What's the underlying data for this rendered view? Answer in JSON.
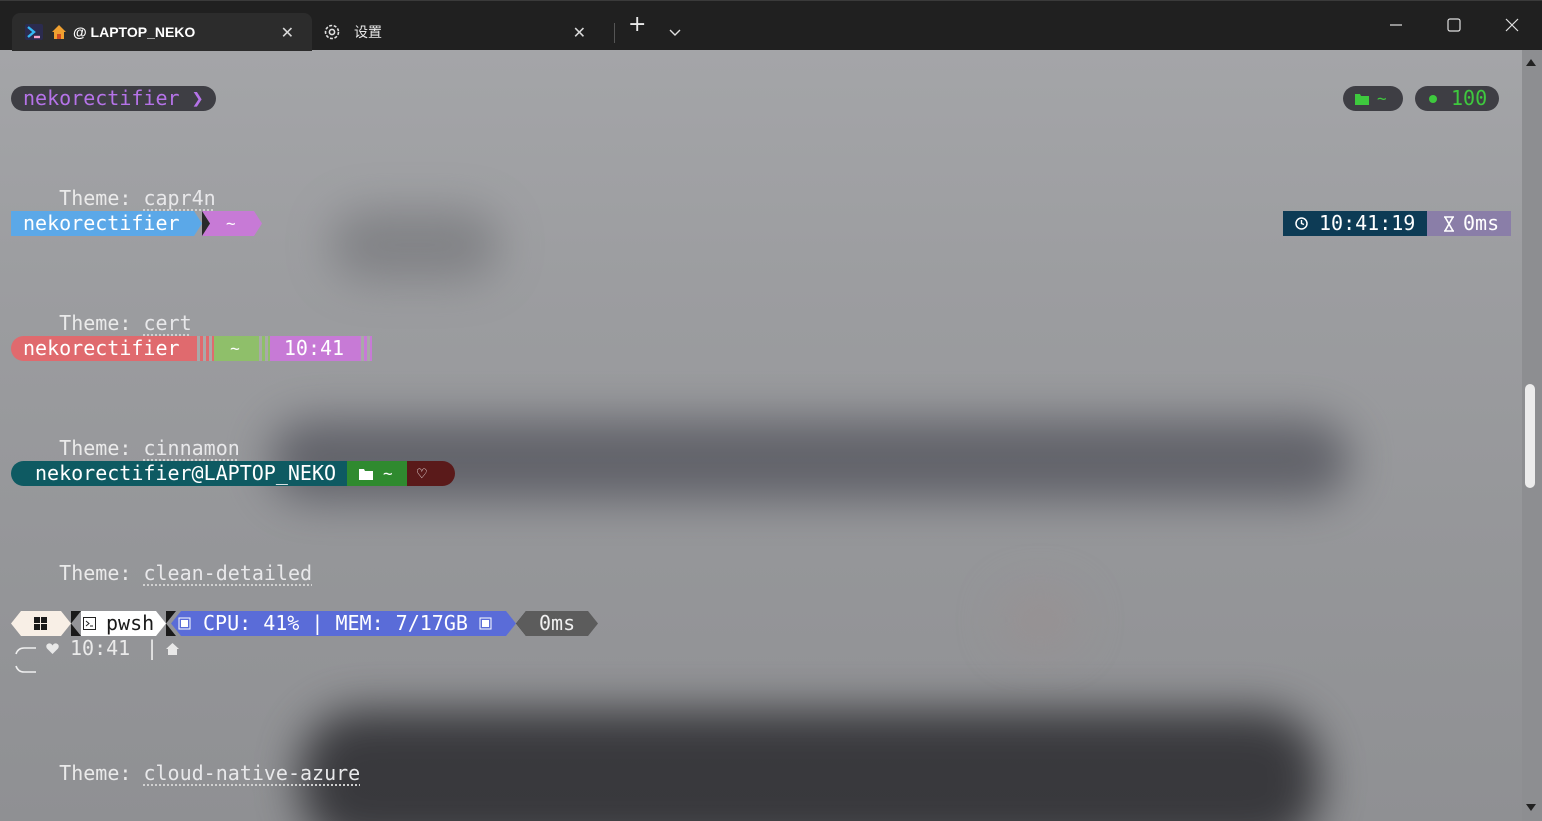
{
  "tabs": [
    {
      "label": "@ LAPTOP_NEKO",
      "active": true
    },
    {
      "label": "设置",
      "active": false
    }
  ],
  "icons": {
    "tab_close": "✕",
    "new_tab": "+",
    "dropdown": "⌄",
    "minimize": "minimize-icon",
    "maximize": "maximize-icon",
    "close": "close-icon"
  },
  "prompts": {
    "p0": {
      "user": "nekorectifier ❯",
      "folder": "~",
      "status": "100"
    },
    "capr4n": {
      "user": "nekorectifier",
      "path": "~",
      "time": "10:41:19",
      "duration": "0ms"
    },
    "cert": {
      "user": "nekorectifier",
      "path": "~",
      "time": "10:41"
    },
    "cinnamon": {
      "user": "nekorectifier@LAPTOP_NEKO",
      "path": "~",
      "heart": "♡"
    },
    "clean": {
      "shell": "pwsh",
      "sys": "CPU: 41% | MEM: 7/17GB",
      "duration": "0ms",
      "time": "10:41",
      "bar": "|"
    }
  },
  "themes": {
    "label": "Theme:",
    "t1": "capr4n",
    "t2": "cert",
    "t3": "cinnamon",
    "t4": "clean-detailed",
    "t5": "cloud-native-azure"
  },
  "colors": {
    "titlebar": "#202020",
    "capr4n_user": "#5ba8e8",
    "capr4n_path": "#c77ad6",
    "cert_user": "#e06a6e",
    "cert_path": "#8fbf6a",
    "cert_time": "#c77ad6",
    "cinnamon_user": "#0e5a62",
    "cinnamon_path": "#2f8a2f",
    "cinnamon_heart": "#5a1a1a",
    "clean_sys": "#5a6cd8"
  }
}
